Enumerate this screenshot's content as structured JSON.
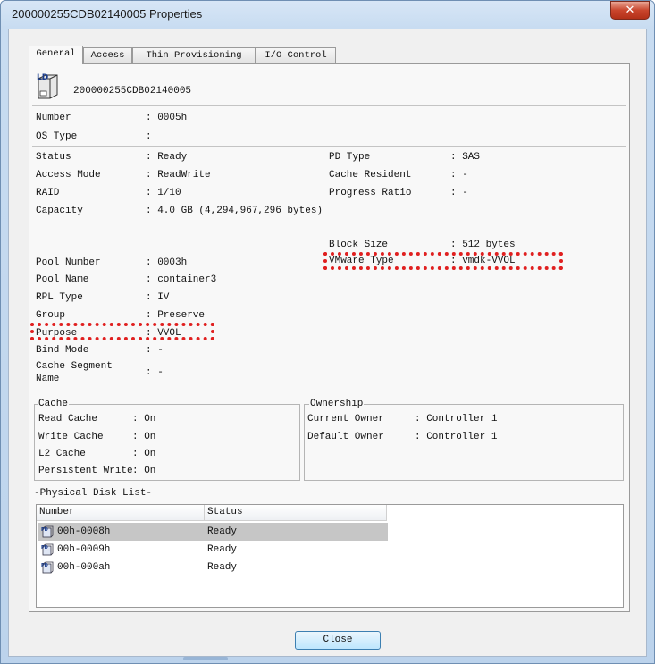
{
  "window": {
    "title": "200000255CDB02140005 Properties",
    "close_glyph": "✕"
  },
  "tabs": [
    "General",
    "Access",
    "Thin Provisioning",
    "I/O Control"
  ],
  "header": {
    "icon_label": "LD",
    "name": "200000255CDB02140005"
  },
  "fields": {
    "number": {
      "label": "Number",
      "value": ": 0005h"
    },
    "os_type": {
      "label": "OS Type",
      "value": ":"
    },
    "status": {
      "label": "Status",
      "value": ": Ready"
    },
    "access_mode": {
      "label": "Access Mode",
      "value": ": ReadWrite"
    },
    "raid": {
      "label": "RAID",
      "value": ": 1/10"
    },
    "capacity": {
      "label": "Capacity",
      "value": ": 4.0 GB (4,294,967,296 bytes)"
    },
    "pd_type": {
      "label": "PD Type",
      "value": ": SAS"
    },
    "cache_resident": {
      "label": "Cache Resident",
      "value": ": -"
    },
    "progress_ratio": {
      "label": "Progress Ratio",
      "value": ": -"
    },
    "block_size": {
      "label": "Block Size",
      "value": ": 512 bytes"
    },
    "vmware_type": {
      "label": "VMware Type",
      "value": ": vmdk-VVOL"
    },
    "pool_number": {
      "label": "Pool Number",
      "value": ": 0003h"
    },
    "pool_name": {
      "label": "Pool Name",
      "value": ": container3"
    },
    "rpl_type": {
      "label": "RPL Type",
      "value": ": IV"
    },
    "group": {
      "label": "Group",
      "value": ": Preserve"
    },
    "purpose": {
      "label": "Purpose",
      "value": ": VVOL"
    },
    "bind_mode": {
      "label": "Bind Mode",
      "value": ": -"
    },
    "cache_segment_name": {
      "label_line1": "Cache Segment",
      "label_line2": "Name",
      "value": ": -"
    }
  },
  "cache": {
    "title": "Cache",
    "read_cache": {
      "label": "Read Cache",
      "value": ": On"
    },
    "write_cache": {
      "label": "Write Cache",
      "value": ": On"
    },
    "l2_cache": {
      "label": "L2 Cache",
      "value": ": On"
    },
    "persistent_write": {
      "label": "Persistent Write",
      "value": ": On"
    }
  },
  "ownership": {
    "title": "Ownership",
    "current_owner": {
      "label": "Current Owner",
      "value": ": Controller 1"
    },
    "default_owner": {
      "label": "Default Owner",
      "value": ": Controller 1"
    }
  },
  "physical_disk_list": {
    "title": "-Physical Disk List-",
    "columns": [
      "Number",
      "Status"
    ],
    "rows": [
      {
        "number": "00h-0008h",
        "status": "Ready",
        "selected": true
      },
      {
        "number": "00h-0009h",
        "status": "Ready",
        "selected": false
      },
      {
        "number": "00h-000ah",
        "status": "Ready",
        "selected": false
      }
    ],
    "icon_text": "PD"
  },
  "buttons": {
    "close": "Close"
  },
  "colors": {
    "highlight_dots": "#e02020",
    "selected_row": "#c6c6c6",
    "title_gradient": "#c8dcf1"
  }
}
